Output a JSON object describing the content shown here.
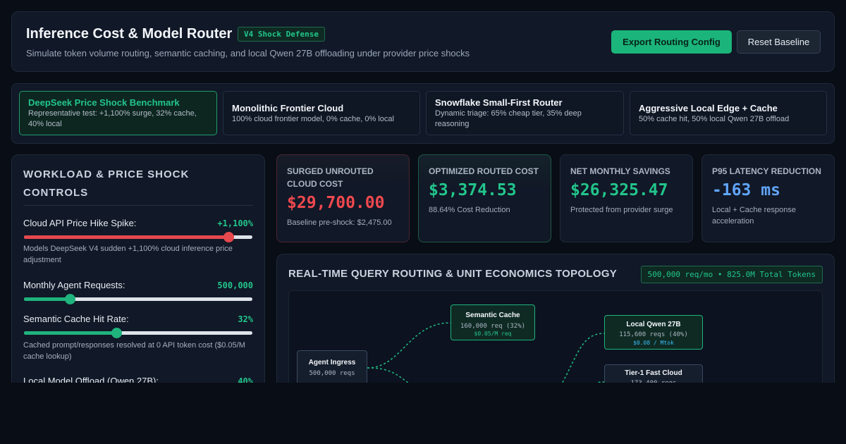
{
  "header": {
    "title": "Inference Cost & Model Router",
    "badge": "V4 Shock Defense",
    "subtitle": "Simulate token volume routing, semantic caching, and local Qwen 27B offloading under provider price shocks",
    "export_label": "Export Routing Config",
    "reset_label": "Reset Baseline"
  },
  "scenarios": [
    {
      "title": "DeepSeek Price Shock Benchmark",
      "desc": "Representative test: +1,100% surge, 32% cache, 40% local",
      "active": true
    },
    {
      "title": "Monolithic Frontier Cloud",
      "desc": "100% cloud frontier model, 0% cache, 0% local",
      "active": false
    },
    {
      "title": "Snowflake Small-First Router",
      "desc": "Dynamic triage: 65% cheap tier, 35% deep reasoning",
      "active": false
    },
    {
      "title": "Aggressive Local Edge + Cache",
      "desc": "50% cache hit, 50% local Qwen 27B offload",
      "active": false
    }
  ],
  "controls": {
    "title": "WORKLOAD & PRICE SHOCK CONTROLS",
    "sliders": [
      {
        "label": "Cloud API Price Hike Spike:",
        "value": "+1,100%",
        "fraction": 0.895,
        "color": "#e5484d",
        "note": "Models DeepSeek V4 sudden +1,100% cloud inference price adjustment"
      },
      {
        "label": "Monthly Agent Requests:",
        "value": "500,000",
        "fraction": 0.2,
        "color": "#1fb37d",
        "note": ""
      },
      {
        "label": "Semantic Cache Hit Rate:",
        "value": "32%",
        "fraction": 0.405,
        "color": "#1fb37d",
        "note": "Cached prompt/responses resolved at 0 API token cost ($0.05/M cache lookup)"
      },
      {
        "label": "Local Model Offload (Qwen 27B):",
        "value": "40%",
        "fraction": 0.4,
        "color": "#1fb37d",
        "note": ""
      }
    ]
  },
  "kpis": [
    {
      "label": "Surged Unrouted Cloud Cost",
      "value": "$29,700.00",
      "sub": "Baseline pre-shock: $2,475.00",
      "color": "#f0494f"
    },
    {
      "label": "Optimized Routed Cost",
      "value": "$3,374.53",
      "sub": "88.64% Cost Reduction",
      "color": "#22c58b"
    },
    {
      "label": "Net Monthly Savings",
      "value": "$26,325.47",
      "sub": "Protected from provider surge",
      "color": "#22c58b"
    },
    {
      "label": "P95 Latency Reduction",
      "value": "-163 ms",
      "sub": "Local + Cache response acceleration",
      "color": "#60a5fa"
    }
  ],
  "topology": {
    "title": "REAL-TIME QUERY ROUTING & UNIT ECONOMICS TOPOLOGY",
    "badge": "500,000 req/mo • 825.0M Total Tokens",
    "nodes": {
      "ingress": {
        "title": "Agent Ingress",
        "line": "500,000 reqs"
      },
      "cache": {
        "title": "Semantic Cache",
        "line": "160,000 req (32%)",
        "price": "$0.05/M req"
      },
      "local": {
        "title": "Local Qwen 27B",
        "line": "115,600 reqs (40%)",
        "price": "$0.08 / Mtok"
      },
      "fast": {
        "title": "Tier-1 Fast Cloud",
        "line": "173,400 reqs"
      }
    },
    "edge_color": "#1fb37d"
  }
}
